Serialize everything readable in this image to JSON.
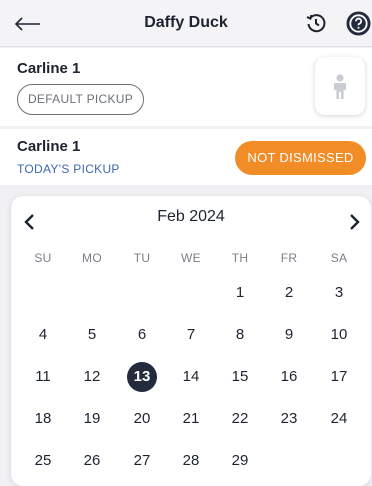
{
  "header": {
    "title": "Daffy Duck",
    "back_icon": "back-arrow-icon",
    "history_icon": "history-icon",
    "help_icon": "help-icon"
  },
  "default_card": {
    "title": "Carline 1",
    "pill_label": "DEFAULT PICKUP",
    "person_icon": "person-icon"
  },
  "today_card": {
    "title": "Carline 1",
    "subtitle": "TODAY'S PICKUP",
    "status_label": "NOT DISMISSED",
    "status_color": "#f28c26"
  },
  "calendar": {
    "month_label": "Feb 2024",
    "weekdays": [
      "SU",
      "MO",
      "TU",
      "WE",
      "TH",
      "FR",
      "SA"
    ],
    "weeks": [
      [
        "",
        "",
        "",
        "",
        "1",
        "2",
        "3"
      ],
      [
        "4",
        "5",
        "6",
        "7",
        "8",
        "9",
        "10"
      ],
      [
        "11",
        "12",
        "13",
        "14",
        "15",
        "16",
        "17"
      ],
      [
        "18",
        "19",
        "20",
        "21",
        "22",
        "23",
        "24"
      ],
      [
        "25",
        "26",
        "27",
        "28",
        "29",
        "",
        ""
      ]
    ],
    "selected_day": "13",
    "selected_color": "#232b3e"
  },
  "colors": {
    "link_blue": "#3c69b0",
    "help_icon_bg": "#232b3e"
  }
}
